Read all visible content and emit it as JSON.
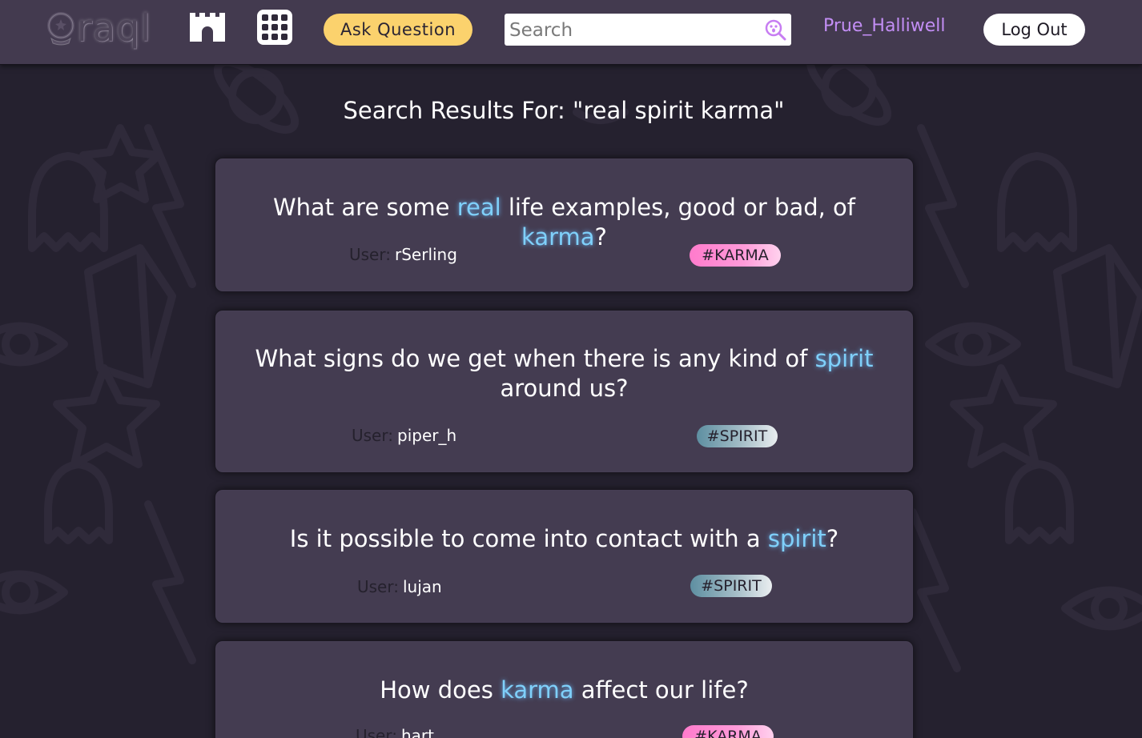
{
  "header": {
    "logo_text": "raql",
    "home_icon": "castle-icon",
    "apps_icon": "grid-icon",
    "ask_button": "Ask Question",
    "search_placeholder": "Search",
    "search_icon": "magnifier-ghost-icon",
    "username": "Prue_Halliwell",
    "logout_button": "Log Out"
  },
  "results": {
    "heading": "Search Results For: \"real spirit karma\"",
    "user_label": "User:",
    "items": [
      {
        "title_parts": [
          {
            "text": "What are some ",
            "hl": false
          },
          {
            "text": "real",
            "hl": true
          },
          {
            "text": " life examples, good or bad, of ",
            "hl": false
          },
          {
            "text": "karma",
            "hl": true
          },
          {
            "text": "?",
            "hl": false
          }
        ],
        "user": "rSerling",
        "tag": "#KARMA"
      },
      {
        "title_parts": [
          {
            "text": "What signs do we get when there is any kind of ",
            "hl": false
          },
          {
            "text": "spirit",
            "hl": true
          },
          {
            "text": " around us?",
            "hl": false
          }
        ],
        "user": "piper_h",
        "tag": "#SPIRIT"
      },
      {
        "title_parts": [
          {
            "text": "Is it possible to come into contact with a ",
            "hl": false
          },
          {
            "text": "spirit",
            "hl": true
          },
          {
            "text": "?",
            "hl": false
          }
        ],
        "user": "lujan",
        "tag": "#SPIRIT"
      },
      {
        "title_parts": [
          {
            "text": "How does ",
            "hl": false
          },
          {
            "text": "karma",
            "hl": true
          },
          {
            "text": " affect our life?",
            "hl": false
          }
        ],
        "user": "hart",
        "tag": "#KARMA"
      }
    ]
  },
  "colors": {
    "background": "#25212f",
    "header": "#433a4f",
    "card": "#443c51",
    "ask_button": "#fbd26d",
    "username": "#c38ef5",
    "highlight": "#7fd0fa",
    "tag_karma": "#ff7bcc",
    "tag_spirit": "#5e8fa1"
  }
}
